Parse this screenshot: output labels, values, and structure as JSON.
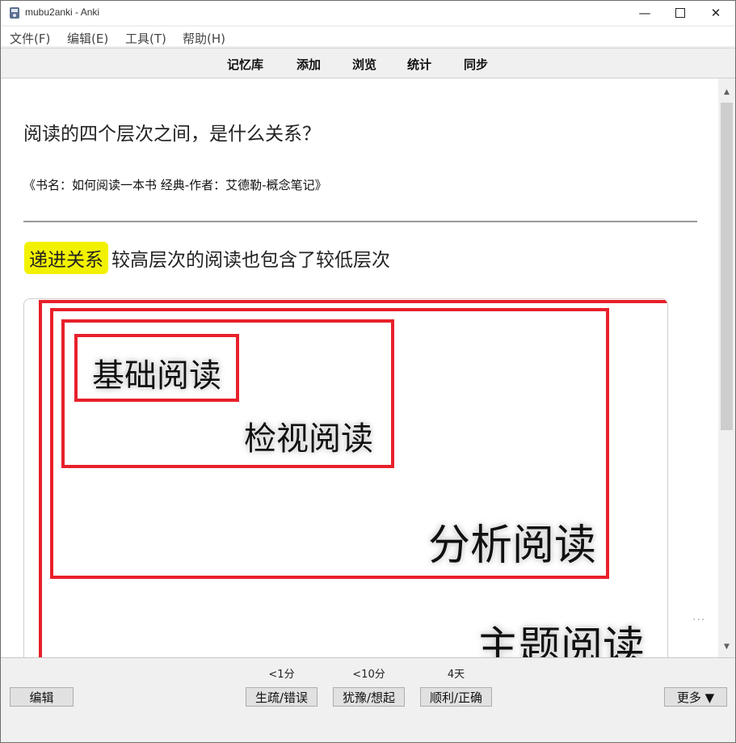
{
  "window": {
    "title": "mubu2anki - Anki",
    "app_icon": "anki-icon"
  },
  "menu": [
    {
      "label": "文件(F)"
    },
    {
      "label": "编辑(E)"
    },
    {
      "label": "工具(T)"
    },
    {
      "label": "帮助(H)"
    }
  ],
  "toolbar": [
    {
      "label": "记忆库"
    },
    {
      "label": "添加"
    },
    {
      "label": "浏览"
    },
    {
      "label": "统计"
    },
    {
      "label": "同步"
    }
  ],
  "card": {
    "question": "阅读的四个层次之间，是什么关系？",
    "source": "《书名：如何阅读一本书 经典-作者：艾德勒-概念笔记》",
    "answer_highlight": "递进关系",
    "answer_rest": "较高层次的阅读也包含了较低层次",
    "highlight_color": "#f2f200",
    "diagram": {
      "box_color": "#e8202a",
      "labels": [
        "基础阅读",
        "检视阅读",
        "分析阅读",
        "主题阅读"
      ]
    }
  },
  "reviewer": {
    "edit_label": "编辑",
    "more_label": "更多 ▼",
    "answers": [
      {
        "interval": "<1分",
        "label": "生疏/错误"
      },
      {
        "interval": "<10分",
        "label": "犹豫/想起"
      },
      {
        "interval": "4天",
        "label": "顺利/正确"
      }
    ]
  }
}
